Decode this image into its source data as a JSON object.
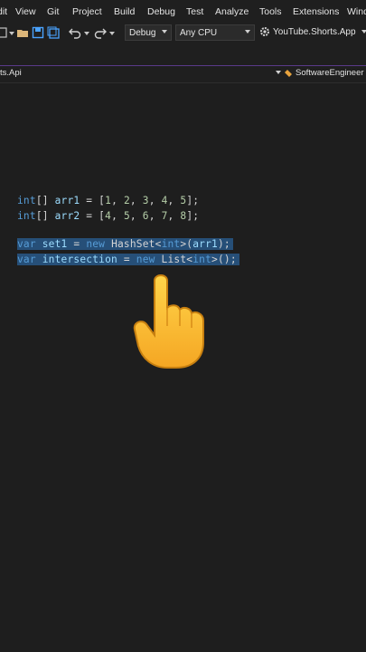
{
  "menu": [
    "Edit",
    "View",
    "Git",
    "Project",
    "Build",
    "Debug",
    "Test",
    "Analyze",
    "Tools",
    "Extensions",
    "Window"
  ],
  "toolbar": {
    "config": "Debug",
    "platform": "Any CPU",
    "startup_project": "YouTube.Shorts.App"
  },
  "nav": {
    "project": "ts.Api",
    "member": "SoftwareEngineer"
  },
  "code": {
    "line1": {
      "t1": "int",
      "t2": "[] ",
      "t3": "arr1",
      "t4": " = [",
      "n1": "1",
      "c1": ", ",
      "n2": "2",
      "c2": ", ",
      "n3": "3",
      "c3": ", ",
      "n4": "4",
      "c4": ", ",
      "n5": "5",
      "t5": "];"
    },
    "line2": {
      "t1": "int",
      "t2": "[] ",
      "t3": "arr2",
      "t4": " = [",
      "n1": "4",
      "c1": ", ",
      "n2": "5",
      "c2": ", ",
      "n3": "6",
      "c3": ", ",
      "n4": "7",
      "c4": ", ",
      "n5": "8",
      "t5": "];"
    },
    "line3": {
      "t1": "var",
      "t2": " ",
      "t3": "set1",
      "t4": " = ",
      "t5": "new",
      "t6": " ",
      "t7": "HashSet",
      "t8": "<",
      "t9": "int",
      "t10": ">(",
      "t11": "arr1",
      "t12": ");"
    },
    "line4": {
      "t1": "var",
      "t2": " ",
      "t3": "intersection",
      "t4": " = ",
      "t5": "new",
      "t6": " ",
      "t7": "List",
      "t8": "<",
      "t9": "int",
      "t10": ">();"
    }
  },
  "colors": {
    "keyword": "#569cd6",
    "type": "#4ec9b0",
    "number": "#b5cea8",
    "variable": "#9cdcfe",
    "selection": "#264f78"
  }
}
